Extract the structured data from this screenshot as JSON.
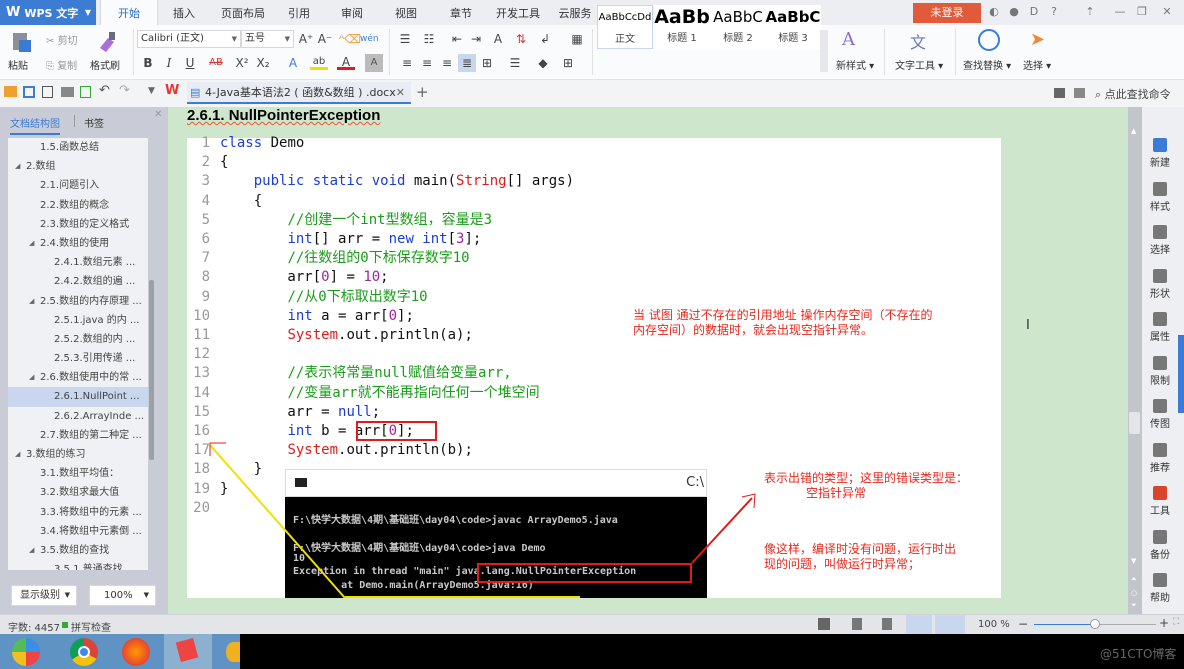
{
  "app": {
    "logo": "WPS 文字",
    "menu_tabs": [
      "开始",
      "插入",
      "页面布局",
      "引用",
      "审阅",
      "视图",
      "章节",
      "开发工具",
      "云服务"
    ],
    "active_tab": "开始",
    "login_button": "未登录"
  },
  "ribbon": {
    "paste": "粘贴",
    "cut": "剪切",
    "copy": "复制",
    "format_painter": "格式刷",
    "font_name": "Calibri (正文)",
    "font_size": "五号",
    "styles": [
      {
        "preview": "AaBbCcDd",
        "name": "正文"
      },
      {
        "preview": "AaBb",
        "name": "标题 1"
      },
      {
        "preview": "AaBbC",
        "name": "标题 2"
      },
      {
        "preview": "AaBbC",
        "name": "标题 3"
      }
    ],
    "new_style": "新样式",
    "text_tools": "文字工具",
    "find_replace": "查找替换",
    "select": "选择",
    "command_search": "点此查找命令"
  },
  "document_tab": {
    "title": "4-Java基本语法2 ( 函数&数组 ) .docx"
  },
  "nav_panel": {
    "tabs": [
      "文档结构图",
      "书签"
    ],
    "active_tab": "文档结构图",
    "items": [
      {
        "label": "1.5.函数总结",
        "level": 2,
        "expander": false
      },
      {
        "label": "2.数组",
        "level": 1,
        "expander": true
      },
      {
        "label": "2.1.问题引入",
        "level": 2,
        "expander": false
      },
      {
        "label": "2.2.数组的概念",
        "level": 2,
        "expander": false
      },
      {
        "label": "2.3.数组的定义格式",
        "level": 2,
        "expander": false
      },
      {
        "label": "2.4.数组的使用",
        "level": 2,
        "expander": true
      },
      {
        "label": "2.4.1.数组元素 ...",
        "level": 3,
        "expander": false
      },
      {
        "label": "2.4.2.数组的遍 ...",
        "level": 3,
        "expander": false
      },
      {
        "label": "2.5.数组的内存原理 ...",
        "level": 2,
        "expander": true
      },
      {
        "label": "2.5.1.java 的内 ...",
        "level": 3,
        "expander": false
      },
      {
        "label": "2.5.2.数组的内 ...",
        "level": 3,
        "expander": false
      },
      {
        "label": "2.5.3.引用传递 ...",
        "level": 3,
        "expander": false
      },
      {
        "label": "2.6.数组使用中的常 ...",
        "level": 2,
        "expander": true
      },
      {
        "label": "2.6.1.NullPoint ...",
        "level": 3,
        "expander": false,
        "selected": true
      },
      {
        "label": "2.6.2.ArrayInde ...",
        "level": 3,
        "expander": false
      },
      {
        "label": "2.7.数组的第二种定 ...",
        "level": 2,
        "expander": false
      },
      {
        "label": "3.数组的练习",
        "level": 1,
        "expander": true
      },
      {
        "label": "3.1.数组平均值：",
        "level": 2,
        "expander": false
      },
      {
        "label": "3.2.数组求最大值",
        "level": 2,
        "expander": false
      },
      {
        "label": "3.3.将数组中的元素 ...",
        "level": 2,
        "expander": false
      },
      {
        "label": "3.4.将数组中元素倒 ...",
        "level": 2,
        "expander": false
      },
      {
        "label": "3.5.数组的查找",
        "level": 2,
        "expander": true
      },
      {
        "label": "3.5.1.普通查找",
        "level": 3,
        "expander": false
      }
    ],
    "display_level": "显示级别",
    "zoom": "100%"
  },
  "document": {
    "heading": "2.6.1. NullPointerException",
    "code_lines": [
      {
        "n": "1",
        "tokens": [
          [
            "kw",
            "class"
          ],
          [
            "pl",
            " Demo"
          ]
        ]
      },
      {
        "n": "2",
        "tokens": [
          [
            "pl",
            "{"
          ]
        ]
      },
      {
        "n": "3",
        "tokens": [
          [
            "pl",
            "    "
          ],
          [
            "kw",
            "public static void"
          ],
          [
            "pl",
            " main("
          ],
          [
            "str",
            "String"
          ],
          [
            "pl",
            "[] args)"
          ]
        ]
      },
      {
        "n": "4",
        "tokens": [
          [
            "pl",
            "    {"
          ]
        ]
      },
      {
        "n": "5",
        "tokens": [
          [
            "pl",
            "        "
          ],
          [
            "cm",
            "//创建一个int型数组，容量是3"
          ]
        ]
      },
      {
        "n": "6",
        "tokens": [
          [
            "pl",
            "        "
          ],
          [
            "kw",
            "int"
          ],
          [
            "pl",
            "[] arr = "
          ],
          [
            "kw",
            "new int"
          ],
          [
            "pl",
            "["
          ],
          [
            "num",
            "3"
          ],
          [
            "pl",
            "];"
          ]
        ]
      },
      {
        "n": "7",
        "tokens": [
          [
            "pl",
            "        "
          ],
          [
            "cm",
            "//往数组的0下标保存数字10"
          ]
        ]
      },
      {
        "n": "8",
        "tokens": [
          [
            "pl",
            "        arr["
          ],
          [
            "num",
            "0"
          ],
          [
            "pl",
            "] = "
          ],
          [
            "num",
            "10"
          ],
          [
            "pl",
            ";"
          ]
        ]
      },
      {
        "n": "9",
        "tokens": [
          [
            "pl",
            "        "
          ],
          [
            "cm",
            "//从0下标取出数字10"
          ]
        ]
      },
      {
        "n": "10",
        "tokens": [
          [
            "pl",
            "        "
          ],
          [
            "kw",
            "int"
          ],
          [
            "pl",
            " a = arr["
          ],
          [
            "num",
            "0"
          ],
          [
            "pl",
            "];"
          ]
        ]
      },
      {
        "n": "11",
        "tokens": [
          [
            "pl",
            "        "
          ],
          [
            "str",
            "System"
          ],
          [
            "pl",
            ".out.println(a);"
          ]
        ]
      },
      {
        "n": "12",
        "tokens": []
      },
      {
        "n": "13",
        "tokens": [
          [
            "pl",
            "        "
          ],
          [
            "cm",
            "//表示将常量null赋值给变量arr,"
          ]
        ]
      },
      {
        "n": "14",
        "tokens": [
          [
            "pl",
            "        "
          ],
          [
            "cm",
            "//变量arr就不能再指向任何一个堆空间"
          ]
        ]
      },
      {
        "n": "15",
        "tokens": [
          [
            "pl",
            "        arr = "
          ],
          [
            "kw",
            "null"
          ],
          [
            "pl",
            ";"
          ]
        ]
      },
      {
        "n": "16",
        "tokens": [
          [
            "pl",
            "        "
          ],
          [
            "kw",
            "int"
          ],
          [
            "pl",
            " b = arr["
          ],
          [
            "num",
            "0"
          ],
          [
            "pl",
            "];"
          ]
        ]
      },
      {
        "n": "17",
        "tokens": [
          [
            "pl",
            "        "
          ],
          [
            "str",
            "System"
          ],
          [
            "pl",
            ".out.println(b);"
          ]
        ]
      },
      {
        "n": "18",
        "tokens": [
          [
            "pl",
            "    }"
          ]
        ]
      },
      {
        "n": "19",
        "tokens": [
          [
            "pl",
            "}"
          ]
        ]
      },
      {
        "n": "20",
        "tokens": []
      }
    ],
    "console": {
      "title_right": "C:\\",
      "lines": [
        "F:\\快学大数据\\4期\\基础班\\day04\\code>javac ArrayDemo5.java",
        "",
        "F:\\快学大数据\\4期\\基础班\\day04\\code>java Demo",
        "10",
        "Exception in thread \"main\" java.lang.NullPointerException",
        "        at Demo.main(ArrayDemo5.java:16)"
      ]
    },
    "notes": {
      "null_pointer_explanation": [
        "当 试图 通过不存在的引用地址 操作内存空间（不存在的",
        "内存空间）的数据时，就会出现空指针异常。"
      ],
      "error_type": [
        "表示出错的类型；这里的错误类型是：",
        "空指针异常"
      ],
      "runtime_exception": [
        "像这样，编译时没有问题，运行时出",
        "现的问题，叫做运行时异常；"
      ]
    },
    "annotation_color": "#e8281e",
    "arrow_color": "#f0e000"
  },
  "right_panel": {
    "items": [
      {
        "label": "新建",
        "icon": "new-doc-icon",
        "color": "#3a7cd5"
      },
      {
        "label": "样式",
        "icon": "style-icon",
        "color": "#777777"
      },
      {
        "label": "选择",
        "icon": "select-icon",
        "color": "#777777"
      },
      {
        "label": "形状",
        "icon": "shape-icon",
        "color": "#777777"
      },
      {
        "label": "属性",
        "icon": "property-icon",
        "color": "#777777"
      },
      {
        "label": "限制",
        "icon": "restrict-icon",
        "color": "#777777"
      },
      {
        "label": "传图",
        "icon": "upload-image-icon",
        "color": "#777777"
      },
      {
        "label": "推荐",
        "icon": "recommend-icon",
        "color": "#777777"
      },
      {
        "label": "工具",
        "icon": "toolbox-icon",
        "color": "#d9452b"
      },
      {
        "label": "备份",
        "icon": "backup-icon",
        "color": "#777777"
      },
      {
        "label": "帮助",
        "icon": "help-icon",
        "color": "#777777"
      }
    ]
  },
  "statusbar": {
    "word_count": "字数: 4457",
    "spell_check": "拼写检查",
    "zoom_level": "100 %",
    "zoom_fraction": 0.5
  },
  "watermark": "@51CTO博客"
}
